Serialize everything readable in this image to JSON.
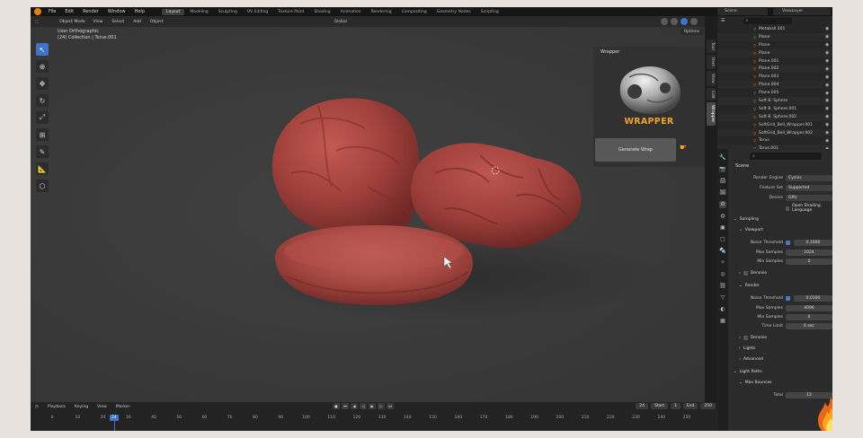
{
  "menubar": {
    "items": [
      "File",
      "Edit",
      "Render",
      "Window",
      "Help"
    ],
    "workspaces": [
      "Layout",
      "Modeling",
      "Sculpting",
      "UV Editing",
      "Texture Paint",
      "Shading",
      "Animation",
      "Rendering",
      "Compositing",
      "Geometry Nodes",
      "Scripting"
    ],
    "active_workspace": "Layout",
    "scene": "Scene",
    "view_layer": "ViewLayer"
  },
  "viewport": {
    "mode": "Object Mode",
    "menus": [
      "View",
      "Select",
      "Add",
      "Object"
    ],
    "transform": "Global",
    "view_name": "User Orthographic",
    "collection": "(24) Collection | Torus.001",
    "options_label": "Options",
    "tools": [
      "select",
      "cursor",
      "move",
      "rotate",
      "scale",
      "transform",
      "annotate",
      "measure",
      "add-cube"
    ],
    "active_tool": "select",
    "shading_modes": [
      "wireframe",
      "solid",
      "material",
      "rendered"
    ],
    "active_shading": "material"
  },
  "wrapper_panel": {
    "title": "Wrapper",
    "brand": "WRAPPER",
    "button_label": "Generate Wrap"
  },
  "npanel_tabs": [
    "Tool",
    "Item",
    "View",
    "Edit",
    "Wrapper"
  ],
  "active_npanel_tab": "Wrapper",
  "timeline": {
    "menus": [
      "Playback",
      "Keying",
      "View",
      "Marker"
    ],
    "current_frame": "24",
    "start_label": "Start",
    "start": "1",
    "end_label": "End",
    "end": "250",
    "ticks": [
      "0",
      "10",
      "20",
      "30",
      "40",
      "50",
      "60",
      "70",
      "80",
      "90",
      "100",
      "110",
      "120",
      "130",
      "140",
      "150",
      "160",
      "170",
      "180",
      "190",
      "200",
      "210",
      "220",
      "230",
      "240",
      "250"
    ]
  },
  "outliner": {
    "search": "⌕",
    "items": [
      "Metaball.001",
      "Plane",
      "Plane",
      "Plane",
      "Plane.001",
      "Plane.002",
      "Plane.003",
      "Plane.004",
      "Plane.005",
      "Soft B. Sphere",
      "Soft B. Sphere.001",
      "Soft B. Sphere.002",
      "SoftGrid_Bell_Wrapper.001",
      "SoftGrid_Bell_Wrapper.002",
      "Torus",
      "Torus.001"
    ]
  },
  "properties": {
    "search": "⌕",
    "section": "Scene",
    "render_engine_label": "Render Engine",
    "render_engine": "Cycles",
    "feature_set_label": "Feature Set",
    "feature_set": "Supported",
    "device_label": "Device",
    "device": "GPU",
    "osl_label": "Open Shading Language",
    "sampling": "Sampling",
    "viewport": "Viewport",
    "noise_threshold_label": "Noise Threshold",
    "vp_threshold": "0.1000",
    "max_samples_label": "Max Samples",
    "vp_max": "1024",
    "min_samples_label": "Min Samples",
    "vp_min": "0",
    "denoise": "Denoise",
    "render": "Render",
    "r_threshold": "0.0100",
    "r_max": "4096",
    "r_min": "0",
    "time_limit_label": "Time Limit",
    "r_time": "0 sec",
    "lights": "Lights",
    "advanced": "Advanced",
    "light_paths": "Light Paths",
    "max_bounces": "Max Bounces",
    "total_label": "Total",
    "total": "12"
  },
  "colors": {
    "accent": "#3f73c5",
    "object_red": "#a0403b",
    "brand_orange": "#f0a229"
  }
}
